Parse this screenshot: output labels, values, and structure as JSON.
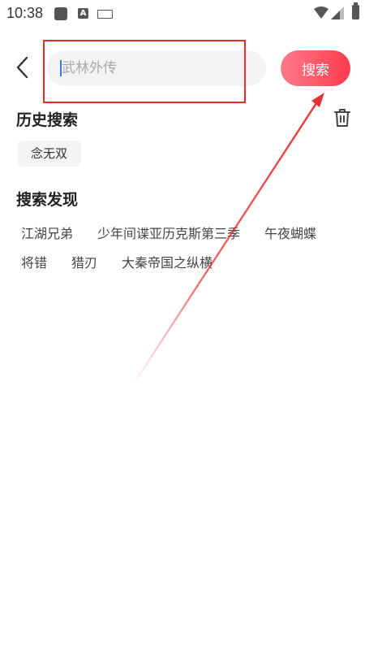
{
  "status_bar": {
    "time": "10:38",
    "icons": [
      "app-square-icon",
      "a-letter-icon",
      "keyboard-icon",
      "wifi-icon",
      "signal-icon",
      "battery-icon"
    ]
  },
  "header": {
    "back_icon": "chevron-left-icon",
    "search_placeholder": "武林外传",
    "search_button_label": "搜索"
  },
  "history": {
    "title": "历史搜索",
    "delete_icon": "trash-icon",
    "items": [
      "念无双"
    ]
  },
  "discover": {
    "title": "搜索发现",
    "rows": [
      [
        "江湖兄弟",
        "少年间谍亚历克斯第三季",
        "午夜蝴蝶"
      ],
      [
        "将错",
        "猎刃",
        "大秦帝国之纵横"
      ]
    ]
  },
  "colors": {
    "accent_start": "#ff7a88",
    "accent_end": "#ff3c4e",
    "annotation": "#e53030",
    "chip_bg": "#f4f4f4"
  }
}
